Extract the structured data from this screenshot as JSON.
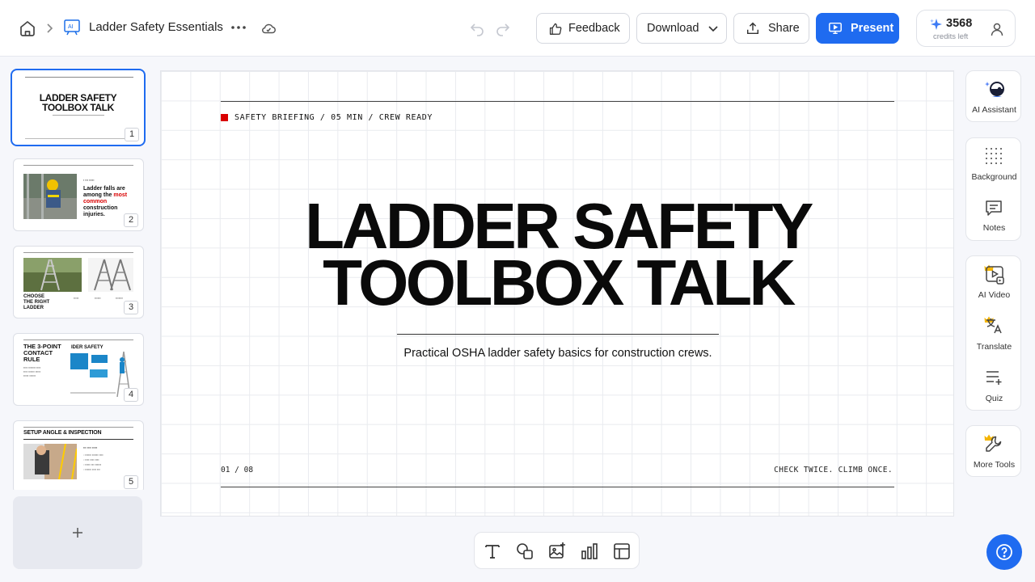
{
  "header": {
    "doc_title": "Ladder Safety Essentials",
    "feedback_label": "Feedback",
    "download_label": "Download",
    "share_label": "Share",
    "present_label": "Present",
    "credits_count": "3568",
    "credits_label": "credits left"
  },
  "thumbnails": [
    {
      "number": "1",
      "title_line1": "LADDER SAFETY",
      "title_line2": "TOOLBOX TALK"
    },
    {
      "number": "2",
      "text_a": "Ladder falls are among the ",
      "text_b": "most common",
      "text_c": " construction injuries."
    },
    {
      "number": "3",
      "title": "CHOOSE THE RIGHT LADDER"
    },
    {
      "number": "4",
      "title": "THE 3-POINT CONTACT RULE"
    },
    {
      "number": "5",
      "title": "SETUP ANGLE & INSPECTION"
    }
  ],
  "slide": {
    "kicker": "SAFETY BRIEFING / 05 MIN / CREW READY",
    "title_line1": "LADDER SAFETY",
    "title_line2": "TOOLBOX TALK",
    "subtitle": "Practical OSHA ladder safety basics for construction crews.",
    "page": "01 / 08",
    "footer": "CHECK TWICE. CLIMB ONCE."
  },
  "tools": {
    "ai_assistant": "AI Assistant",
    "background": "Background",
    "notes": "Notes",
    "ai_video": "AI Video",
    "translate": "Translate",
    "quiz": "Quiz",
    "more_tools": "More Tools"
  },
  "colors": {
    "accent": "#1f6bf0",
    "kicker_square": "#d90000",
    "crown": "#f4b400"
  }
}
